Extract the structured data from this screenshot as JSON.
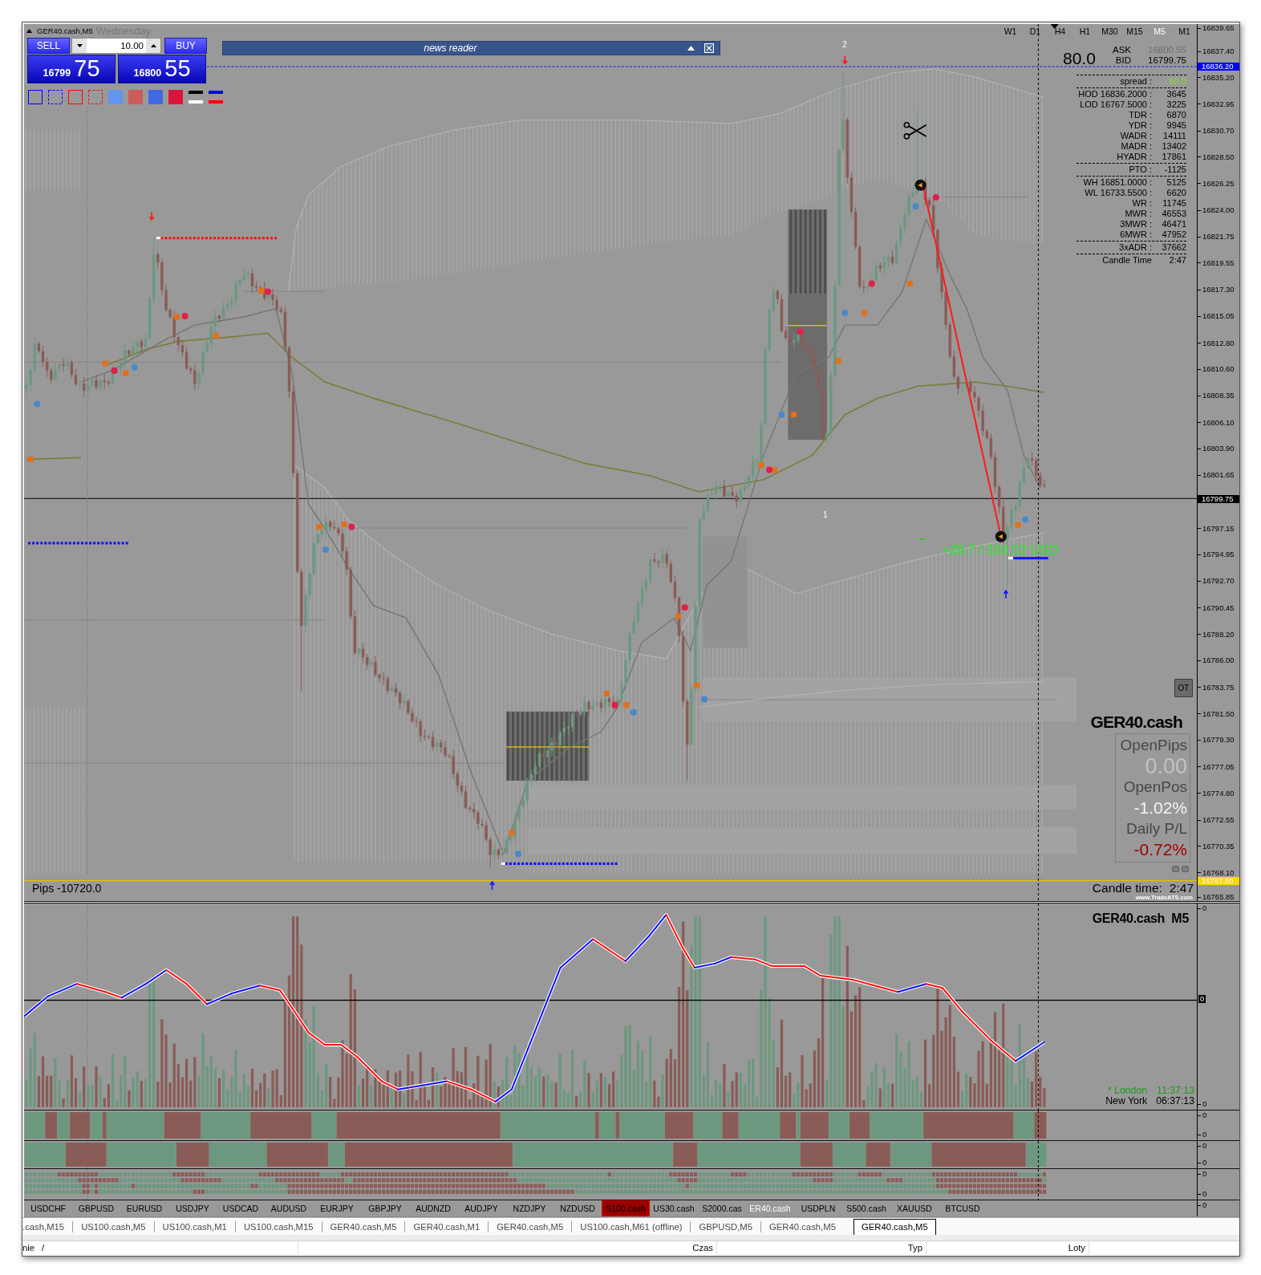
{
  "chart": {
    "title": "GER40.cash,M5",
    "day": "Wednesday"
  },
  "trade_panel": {
    "sell": "SELL",
    "buy": "BUY",
    "lot": "10.00",
    "bid_figure": "16799",
    "bid_pips": "75",
    "ask_figure": "16800",
    "ask_pips": "55"
  },
  "drawing_tools": [
    {
      "kind": "frame",
      "color": "#0000ff",
      "dashed": false
    },
    {
      "kind": "frame",
      "color": "#0000ff",
      "dashed": true
    },
    {
      "kind": "frame",
      "color": "#ff0000",
      "dashed": false
    },
    {
      "kind": "frame",
      "color": "#ff0000",
      "dashed": true
    },
    {
      "kind": "swatch",
      "color": "#6495ed"
    },
    {
      "kind": "swatch",
      "color": "#cd5c5c"
    },
    {
      "kind": "swatch",
      "color": "#4169e1"
    },
    {
      "kind": "swatch",
      "color": "#dc143c"
    },
    {
      "kind": "lines",
      "lines": [
        {
          "color": "#000000"
        },
        {
          "color": "#ffffff"
        }
      ]
    },
    {
      "kind": "lines",
      "lines": [
        {
          "color": "#0000ff"
        },
        {
          "color": "#ff0000"
        }
      ]
    }
  ],
  "news_reader": {
    "title": "news reader"
  },
  "timeframes": [
    {
      "label": "W1",
      "selected": false
    },
    {
      "label": "D1",
      "selected": false
    },
    {
      "label": "H4",
      "selected": false
    },
    {
      "label": "H1",
      "selected": false
    },
    {
      "label": "M30",
      "selected": false
    },
    {
      "label": "M15",
      "selected": false
    },
    {
      "label": "M5",
      "selected": true
    },
    {
      "label": "M1",
      "selected": false
    }
  ],
  "quote": {
    "spread": "80.0",
    "ask_label": "ASK",
    "ask": "16800.55",
    "bid_label": "BID",
    "bid": "16799.75"
  },
  "stats": [
    {
      "rows": [
        {
          "label": "spread :",
          "value": "80.0",
          "kind": "highlight"
        }
      ]
    },
    {
      "rows": [
        {
          "label": "HOD",
          "price": "16836.2000 :",
          "value": "3645",
          "kind": "plain"
        },
        {
          "label": "LOD",
          "price": "16767.5000 :",
          "value": "3225",
          "kind": "plain"
        },
        {
          "label": "TDR :",
          "value": "6870",
          "kind": "plain"
        },
        {
          "label": "YDR :",
          "value": "9945",
          "kind": "plain"
        },
        {
          "label": "WADR :",
          "value": "14111",
          "kind": "plain"
        },
        {
          "label": "MADR :",
          "value": "13402",
          "kind": "plain"
        },
        {
          "label": "HYADR :",
          "value": "17861",
          "kind": "plain"
        }
      ]
    },
    {
      "rows": [
        {
          "label": "PTO :",
          "value": "-1125",
          "kind": "plain"
        }
      ]
    },
    {
      "rows": [
        {
          "label": "WH",
          "price": "16851.0000 :",
          "value": "5125",
          "kind": "plain"
        },
        {
          "label": "WL",
          "price": "16733.5500 :",
          "value": "6620",
          "kind": "plain"
        },
        {
          "label": "WR :",
          "value": "11745",
          "kind": "plain"
        },
        {
          "label": "MWR :",
          "value": "46553",
          "kind": "plain"
        },
        {
          "label": "3MWR :",
          "value": "46471",
          "kind": "plain"
        },
        {
          "label": "6MWR :",
          "value": "47952",
          "kind": "plain"
        }
      ]
    },
    {
      "rows": [
        {
          "label": "3xADR :",
          "value": "37662",
          "kind": "plain"
        }
      ]
    },
    {
      "rows": [
        {
          "label": "Candle Time",
          "value": "2:47",
          "kind": "plain"
        }
      ]
    }
  ],
  "chart_labels": [
    "2",
    "1"
  ],
  "pips": "Pips -10720.0",
  "trade_result": "+29.7 / 320.02 USD",
  "ot_button": "OT",
  "account": {
    "symbol": "GER40.cash",
    "metrics": [
      {
        "label": "OpenPips",
        "value": "0.00",
        "kind": "pips"
      },
      {
        "label": "OpenPos",
        "value": "-1.02%",
        "kind": "muted"
      },
      {
        "label": "Daily P/L",
        "value": "-0.72%",
        "kind": "loss"
      }
    ]
  },
  "candle_time": {
    "label": "Candle time:",
    "value": "2:47"
  },
  "credit": "www.TradeATS.com",
  "price_scale": {
    "ticks": [
      "16839.65",
      "16837.40",
      "16835.20",
      "16832.95",
      "16830.70",
      "16828.50",
      "16826.25",
      "16824.00",
      "16821.75",
      "16819.55",
      "16817.30",
      "16815.05",
      "16812.80",
      "16810.60",
      "16808.35",
      "16806.10",
      "16803.90",
      "16801.65",
      "16797.15",
      "16794.95",
      "16792.70",
      "16790.45",
      "16788.20",
      "16786.00",
      "16783.75",
      "16781.50",
      "16779.30",
      "16777.05",
      "16774.80",
      "16772.55",
      "16770.35",
      "16768.10",
      "16765.85"
    ],
    "markers": [
      {
        "label": "16836.20",
        "color": "#0000ff"
      },
      {
        "label": "16799.75",
        "color": "#000000"
      },
      {
        "label": "16767.50",
        "color": "#ffd700"
      }
    ]
  },
  "indicator": {
    "title": "GER40.cash  M5",
    "clocks": [
      {
        "city": "* London",
        "time": "11:37:13",
        "open": true
      },
      {
        "city": "New York",
        "time": "06:37:13",
        "open": false
      }
    ],
    "scale": [
      {
        "label": "0",
        "kind": "tick"
      },
      {
        "label": "0",
        "kind": "marker"
      },
      {
        "label": "0",
        "kind": "tick"
      }
    ]
  },
  "strips": [
    {
      "scale": [
        "0",
        "0"
      ]
    },
    {
      "scale": [
        "0",
        "0"
      ]
    },
    {
      "scale": [
        "0",
        "0"
      ]
    }
  ],
  "symbol_bar": {
    "scale": "0",
    "symbols": [
      {
        "label": "USDCHF",
        "selected": false,
        "flagged": false
      },
      {
        "label": "GBPUSD",
        "selected": false,
        "flagged": false
      },
      {
        "label": "EURUSD",
        "selected": false,
        "flagged": false
      },
      {
        "label": "USDJPY",
        "selected": false,
        "flagged": false
      },
      {
        "label": "USDCAD",
        "selected": false,
        "flagged": false
      },
      {
        "label": "AUDUSD",
        "selected": false,
        "flagged": false
      },
      {
        "label": "EURJPY",
        "selected": false,
        "flagged": false
      },
      {
        "label": "GBPJPY",
        "selected": false,
        "flagged": false
      },
      {
        "label": "AUDNZD",
        "selected": false,
        "flagged": false
      },
      {
        "label": "AUDJPY",
        "selected": false,
        "flagged": false
      },
      {
        "label": "NZDJPY",
        "selected": false,
        "flagged": false
      },
      {
        "label": "NZDUSD",
        "selected": false,
        "flagged": false
      },
      {
        "label": "S100.cash",
        "selected": false,
        "flagged": true
      },
      {
        "label": "US30.cash",
        "selected": false,
        "flagged": false
      },
      {
        "label": "S2000.cas",
        "selected": false,
        "flagged": false
      },
      {
        "label": "ER40.cash",
        "selected": true,
        "flagged": false
      },
      {
        "label": "USDPLN",
        "selected": false,
        "flagged": false
      },
      {
        "label": "S500.cash",
        "selected": false,
        "flagged": false
      },
      {
        "label": "XAUUSD",
        "selected": false,
        "flagged": false
      },
      {
        "label": "BTCUSD",
        "selected": false,
        "flagged": false
      }
    ]
  },
  "tabs": [
    {
      "label": ".cash,M15",
      "selected": false
    },
    {
      "label": "US100.cash,M5",
      "selected": false
    },
    {
      "label": "US100.cash,M1",
      "selected": false
    },
    {
      "label": "US100.cash,M15",
      "selected": false
    },
    {
      "label": "GER40.cash,M5",
      "selected": false
    },
    {
      "label": "GER40.cash,M1",
      "selected": false
    },
    {
      "label": "GER40.cash,M5",
      "selected": false
    },
    {
      "label": "US100.cash,M61 (offline)",
      "selected": false
    },
    {
      "label": "GBPUSD,M5",
      "selected": false
    },
    {
      "label": "GER40.cash,M5",
      "selected": false
    },
    {
      "label": "GER40.cash,M5",
      "selected": true
    }
  ],
  "status_bar": {
    "columns": [
      {
        "label": "nie",
        "sort": "/"
      },
      {
        "label": "Czas"
      },
      {
        "label": "Typ"
      },
      {
        "label": "Loty"
      }
    ]
  }
}
